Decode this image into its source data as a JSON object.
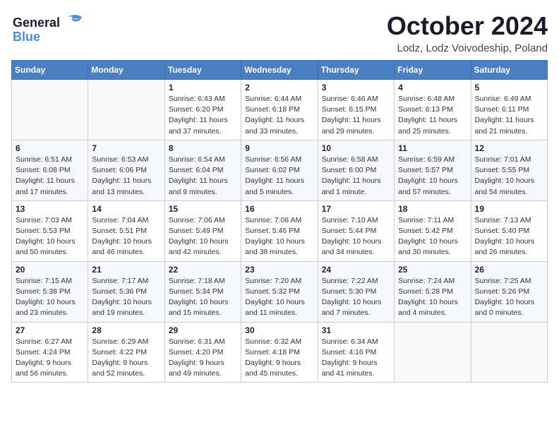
{
  "header": {
    "logo_line1": "General",
    "logo_line2": "Blue",
    "month_title": "October 2024",
    "location": "Lodz, Lodz Voivodeship, Poland"
  },
  "weekdays": [
    "Sunday",
    "Monday",
    "Tuesday",
    "Wednesday",
    "Thursday",
    "Friday",
    "Saturday"
  ],
  "weeks": [
    [
      {
        "day": "",
        "sunrise": "",
        "sunset": "",
        "daylight": ""
      },
      {
        "day": "",
        "sunrise": "",
        "sunset": "",
        "daylight": ""
      },
      {
        "day": "1",
        "sunrise": "Sunrise: 6:43 AM",
        "sunset": "Sunset: 6:20 PM",
        "daylight": "Daylight: 11 hours and 37 minutes."
      },
      {
        "day": "2",
        "sunrise": "Sunrise: 6:44 AM",
        "sunset": "Sunset: 6:18 PM",
        "daylight": "Daylight: 11 hours and 33 minutes."
      },
      {
        "day": "3",
        "sunrise": "Sunrise: 6:46 AM",
        "sunset": "Sunset: 6:15 PM",
        "daylight": "Daylight: 11 hours and 29 minutes."
      },
      {
        "day": "4",
        "sunrise": "Sunrise: 6:48 AM",
        "sunset": "Sunset: 6:13 PM",
        "daylight": "Daylight: 11 hours and 25 minutes."
      },
      {
        "day": "5",
        "sunrise": "Sunrise: 6:49 AM",
        "sunset": "Sunset: 6:11 PM",
        "daylight": "Daylight: 11 hours and 21 minutes."
      }
    ],
    [
      {
        "day": "6",
        "sunrise": "Sunrise: 6:51 AM",
        "sunset": "Sunset: 6:08 PM",
        "daylight": "Daylight: 11 hours and 17 minutes."
      },
      {
        "day": "7",
        "sunrise": "Sunrise: 6:53 AM",
        "sunset": "Sunset: 6:06 PM",
        "daylight": "Daylight: 11 hours and 13 minutes."
      },
      {
        "day": "8",
        "sunrise": "Sunrise: 6:54 AM",
        "sunset": "Sunset: 6:04 PM",
        "daylight": "Daylight: 11 hours and 9 minutes."
      },
      {
        "day": "9",
        "sunrise": "Sunrise: 6:56 AM",
        "sunset": "Sunset: 6:02 PM",
        "daylight": "Daylight: 11 hours and 5 minutes."
      },
      {
        "day": "10",
        "sunrise": "Sunrise: 6:58 AM",
        "sunset": "Sunset: 6:00 PM",
        "daylight": "Daylight: 11 hours and 1 minute."
      },
      {
        "day": "11",
        "sunrise": "Sunrise: 6:59 AM",
        "sunset": "Sunset: 5:57 PM",
        "daylight": "Daylight: 10 hours and 57 minutes."
      },
      {
        "day": "12",
        "sunrise": "Sunrise: 7:01 AM",
        "sunset": "Sunset: 5:55 PM",
        "daylight": "Daylight: 10 hours and 54 minutes."
      }
    ],
    [
      {
        "day": "13",
        "sunrise": "Sunrise: 7:03 AM",
        "sunset": "Sunset: 5:53 PM",
        "daylight": "Daylight: 10 hours and 50 minutes."
      },
      {
        "day": "14",
        "sunrise": "Sunrise: 7:04 AM",
        "sunset": "Sunset: 5:51 PM",
        "daylight": "Daylight: 10 hours and 46 minutes."
      },
      {
        "day": "15",
        "sunrise": "Sunrise: 7:06 AM",
        "sunset": "Sunset: 5:49 PM",
        "daylight": "Daylight: 10 hours and 42 minutes."
      },
      {
        "day": "16",
        "sunrise": "Sunrise: 7:08 AM",
        "sunset": "Sunset: 5:46 PM",
        "daylight": "Daylight: 10 hours and 38 minutes."
      },
      {
        "day": "17",
        "sunrise": "Sunrise: 7:10 AM",
        "sunset": "Sunset: 5:44 PM",
        "daylight": "Daylight: 10 hours and 34 minutes."
      },
      {
        "day": "18",
        "sunrise": "Sunrise: 7:11 AM",
        "sunset": "Sunset: 5:42 PM",
        "daylight": "Daylight: 10 hours and 30 minutes."
      },
      {
        "day": "19",
        "sunrise": "Sunrise: 7:13 AM",
        "sunset": "Sunset: 5:40 PM",
        "daylight": "Daylight: 10 hours and 26 minutes."
      }
    ],
    [
      {
        "day": "20",
        "sunrise": "Sunrise: 7:15 AM",
        "sunset": "Sunset: 5:38 PM",
        "daylight": "Daylight: 10 hours and 23 minutes."
      },
      {
        "day": "21",
        "sunrise": "Sunrise: 7:17 AM",
        "sunset": "Sunset: 5:36 PM",
        "daylight": "Daylight: 10 hours and 19 minutes."
      },
      {
        "day": "22",
        "sunrise": "Sunrise: 7:18 AM",
        "sunset": "Sunset: 5:34 PM",
        "daylight": "Daylight: 10 hours and 15 minutes."
      },
      {
        "day": "23",
        "sunrise": "Sunrise: 7:20 AM",
        "sunset": "Sunset: 5:32 PM",
        "daylight": "Daylight: 10 hours and 11 minutes."
      },
      {
        "day": "24",
        "sunrise": "Sunrise: 7:22 AM",
        "sunset": "Sunset: 5:30 PM",
        "daylight": "Daylight: 10 hours and 7 minutes."
      },
      {
        "day": "25",
        "sunrise": "Sunrise: 7:24 AM",
        "sunset": "Sunset: 5:28 PM",
        "daylight": "Daylight: 10 hours and 4 minutes."
      },
      {
        "day": "26",
        "sunrise": "Sunrise: 7:25 AM",
        "sunset": "Sunset: 5:26 PM",
        "daylight": "Daylight: 10 hours and 0 minutes."
      }
    ],
    [
      {
        "day": "27",
        "sunrise": "Sunrise: 6:27 AM",
        "sunset": "Sunset: 4:24 PM",
        "daylight": "Daylight: 9 hours and 56 minutes."
      },
      {
        "day": "28",
        "sunrise": "Sunrise: 6:29 AM",
        "sunset": "Sunset: 4:22 PM",
        "daylight": "Daylight: 9 hours and 52 minutes."
      },
      {
        "day": "29",
        "sunrise": "Sunrise: 6:31 AM",
        "sunset": "Sunset: 4:20 PM",
        "daylight": "Daylight: 9 hours and 49 minutes."
      },
      {
        "day": "30",
        "sunrise": "Sunrise: 6:32 AM",
        "sunset": "Sunset: 4:18 PM",
        "daylight": "Daylight: 9 hours and 45 minutes."
      },
      {
        "day": "31",
        "sunrise": "Sunrise: 6:34 AM",
        "sunset": "Sunset: 4:16 PM",
        "daylight": "Daylight: 9 hours and 41 minutes."
      },
      {
        "day": "",
        "sunrise": "",
        "sunset": "",
        "daylight": ""
      },
      {
        "day": "",
        "sunrise": "",
        "sunset": "",
        "daylight": ""
      }
    ]
  ]
}
